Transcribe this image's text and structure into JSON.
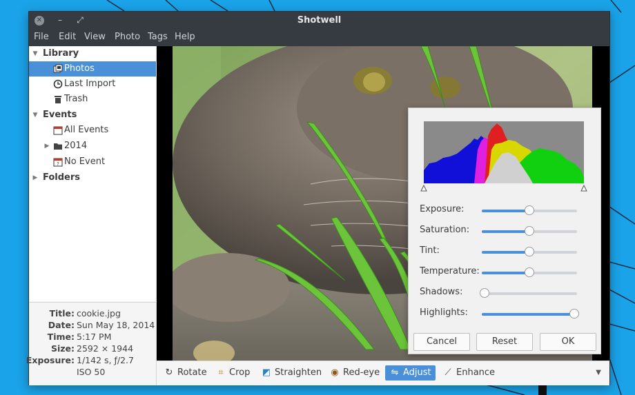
{
  "window": {
    "title": "Shotwell"
  },
  "menu": [
    "File",
    "Edit",
    "View",
    "Photo",
    "Tags",
    "Help"
  ],
  "sidebar": {
    "items": [
      {
        "label": "Library",
        "type": "header",
        "expanded": true,
        "icon": ""
      },
      {
        "label": "Photos",
        "type": "item",
        "icon": "photos-icon",
        "selected": true
      },
      {
        "label": "Last Import",
        "type": "item",
        "icon": "clock-icon"
      },
      {
        "label": "Trash",
        "type": "item",
        "icon": "trash-icon"
      },
      {
        "label": "Events",
        "type": "header",
        "expanded": true,
        "icon": ""
      },
      {
        "label": "All Events",
        "type": "item",
        "icon": "calendar-icon"
      },
      {
        "label": "2014",
        "type": "item",
        "icon": "folder-icon",
        "expandable": true
      },
      {
        "label": "No Event",
        "type": "item",
        "icon": "no-event-icon"
      },
      {
        "label": "Folders",
        "type": "header",
        "expanded": false,
        "icon": ""
      }
    ]
  },
  "metadata": {
    "rows": [
      {
        "key": "Title:",
        "value": "cookie.jpg"
      },
      {
        "key": "Date:",
        "value": "Sun May 18, 2014"
      },
      {
        "key": "Time:",
        "value": "5:17 PM"
      },
      {
        "key": "Size:",
        "value": "2592 × 1944"
      },
      {
        "key": "Exposure:",
        "value": "1/142 s, ƒ/2.7"
      },
      {
        "key": "",
        "value": "ISO 50"
      }
    ]
  },
  "toolbar": {
    "buttons": [
      {
        "label": "Rotate",
        "icon": "rotate-icon",
        "glyph": "↻"
      },
      {
        "label": "Crop",
        "icon": "crop-icon",
        "glyph": "⌗"
      },
      {
        "label": "Straighten",
        "icon": "straighten-icon",
        "glyph": "◩"
      },
      {
        "label": "Red-eye",
        "icon": "red-eye-icon",
        "glyph": "◉"
      },
      {
        "label": "Adjust",
        "icon": "adjust-icon",
        "glyph": "⇋",
        "active": true
      },
      {
        "label": "Enhance",
        "icon": "enhance-icon",
        "glyph": "⟋"
      }
    ],
    "overflow_icon": "chevron-down-icon"
  },
  "adjust_dialog": {
    "sliders": [
      {
        "label": "Exposure:",
        "value": 0.5
      },
      {
        "label": "Saturation:",
        "value": 0.5
      },
      {
        "label": "Tint:",
        "value": 0.5
      },
      {
        "label": "Temperature:",
        "value": 0.5
      },
      {
        "label": "Shadows:",
        "value": 0.03
      },
      {
        "label": "Highlights:",
        "value": 0.97
      }
    ],
    "buttons": {
      "cancel": "Cancel",
      "reset": "Reset",
      "ok": "OK"
    }
  },
  "colors": {
    "accent": "#4a90d9",
    "titlebar": "#353b40",
    "desktop": "#1aa3e8",
    "histogram_red": "#e02020",
    "histogram_green": "#10d010",
    "histogram_blue": "#1010d8",
    "histogram_magenta": "#e020e0",
    "histogram_yellow": "#d8d800"
  }
}
